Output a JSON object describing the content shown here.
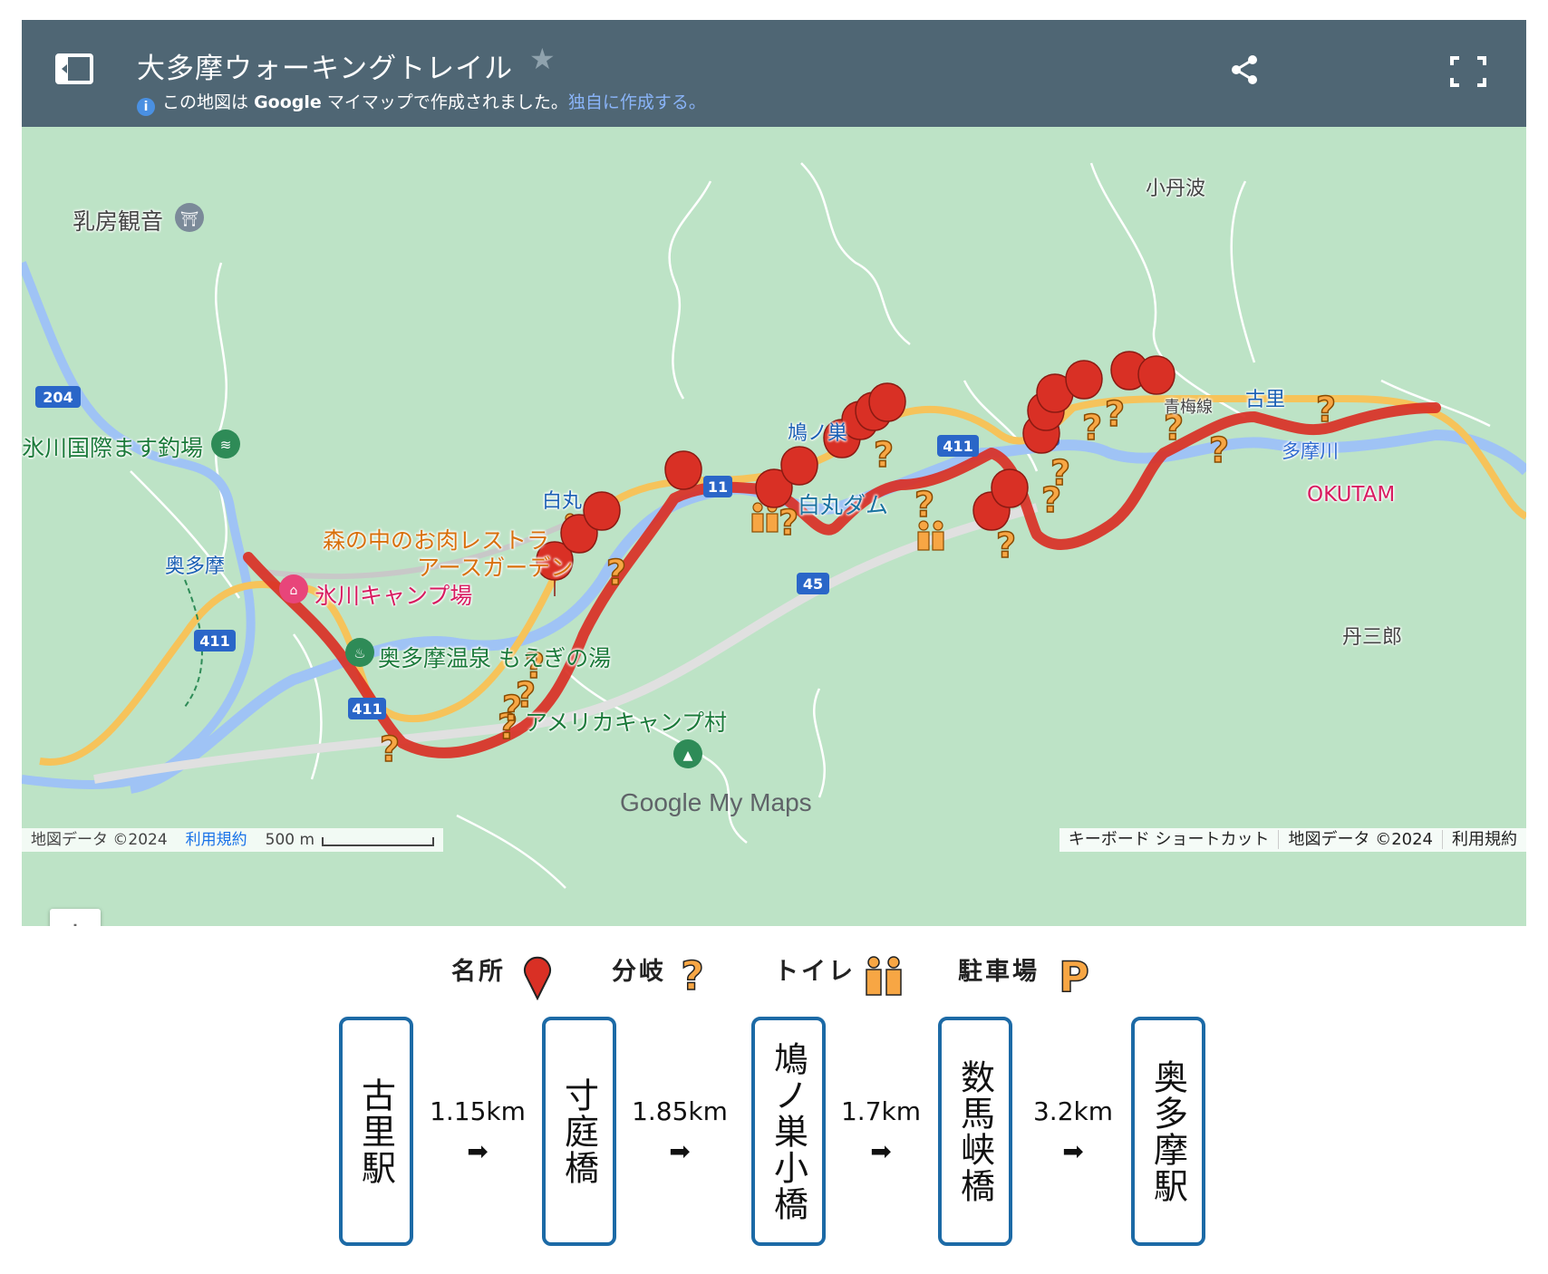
{
  "header": {
    "title": "大多摩ウォーキングトレイル",
    "notice_prefix": "この地図は",
    "notice_brand": "Google",
    "notice_mid": "マイマップで作成されました。",
    "notice_link": "独自に作成する。",
    "icons": [
      "sidebar-toggle-icon",
      "star-icon",
      "info-icon",
      "share-icon",
      "fullscreen-icon"
    ]
  },
  "map": {
    "place_labels": {
      "nyubo_kannon": "乳房観音",
      "hikawa_kokusai": "氷川国際ます釣場",
      "okutama_station": "奥多摩駅",
      "okutama_station_partial": "奥多摩",
      "hikawa_camp": "氷川キャンプ場",
      "onsen": "奥多摩温泉 もえぎの湯",
      "america_camp": "アメリカキャンプ村",
      "restaurant_1": "森の中のお肉レストラ",
      "restaurant_2": "アースガーデン",
      "shiromaru": "白丸",
      "shiromaru_dam": "白丸ダム",
      "hatonosu": "鳩ノ巣",
      "kotaba": "小丹波",
      "kori": "古里",
      "tama_river": "多摩川",
      "okutama_town": "OKUTAM",
      "tansaburo": "丹三郎",
      "line": "青梅線"
    },
    "route_shields": [
      "204",
      "411",
      "411",
      "45",
      "45",
      "411",
      "11"
    ],
    "zoom_in": "+",
    "zoom_out": "−",
    "brand": "Google My Maps",
    "attribution_left": {
      "data": "地図データ ©2024",
      "terms": "利用規約",
      "scale": "500 m"
    },
    "attribution_right": {
      "shortcuts": "キーボード ショートカット",
      "data": "地図データ ©2024",
      "terms": "利用規約"
    },
    "colors": {
      "route": "#d93025",
      "land": "#bde3c6",
      "river": "#9fc3f5",
      "road_major": "#f6c35a",
      "marker_red": "#d93025",
      "marker_orange": "#f7a644"
    }
  },
  "legend": {
    "sight": "名所",
    "junction": "分岐",
    "toilet": "トイレ",
    "parking": "駐車場"
  },
  "stations": [
    "古里駅",
    "寸庭橋",
    "鳩ノ巣小橋",
    "数馬峡橋",
    "奥多摩駅"
  ],
  "distances": [
    "1.15km",
    "1.85km",
    "1.7km",
    "3.2km"
  ],
  "arrow": "➡"
}
